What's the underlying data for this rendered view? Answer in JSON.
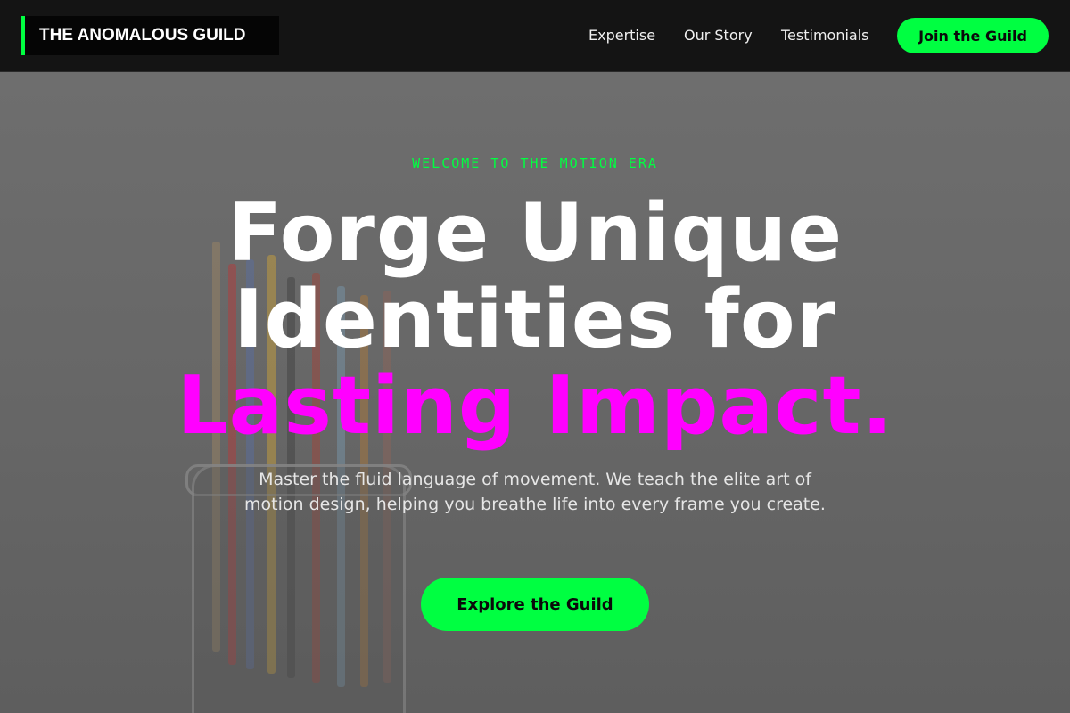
{
  "header": {
    "logo_text": "THE ANOMALOUS GUILD",
    "nav": [
      {
        "label": "Expertise"
      },
      {
        "label": "Our Story"
      },
      {
        "label": "Testimonials"
      }
    ],
    "cta_label": "Join the Guild"
  },
  "hero": {
    "eyebrow": "WELCOME TO THE MOTION ERA",
    "headline_line1": "Forge Unique",
    "headline_line2": "Identities for",
    "headline_accent": "Lasting Impact.",
    "subtext": "Master the fluid language of movement. We teach the elite art of motion design, helping you breathe life into every frame you create.",
    "cta_label": "Explore the Guild"
  },
  "colors": {
    "accent_green": "#00ff41",
    "accent_magenta": "#ff00ff",
    "header_bg": "#141414"
  }
}
